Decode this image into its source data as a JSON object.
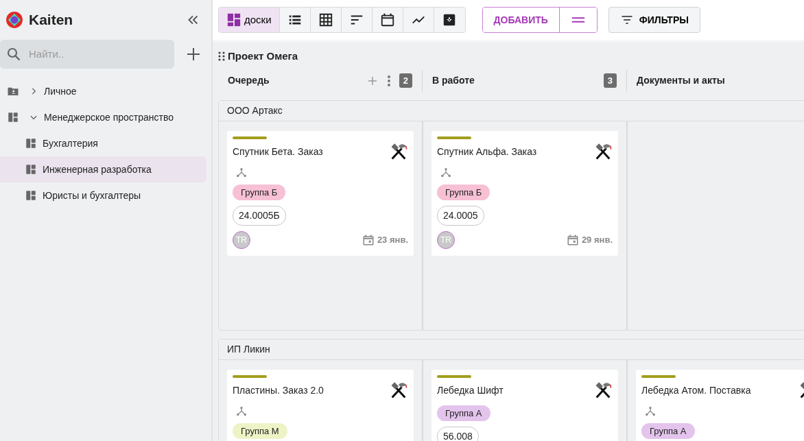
{
  "app": {
    "name": "Kaiten"
  },
  "sidebar": {
    "search": {
      "placeholder": "Найти.."
    },
    "items": [
      {
        "label": "Личное",
        "kind": "folder",
        "expanded": false,
        "selected": false
      },
      {
        "label": "Менеджерское пространство",
        "kind": "space",
        "expanded": true,
        "selected": false,
        "children": [
          {
            "label": "Бухгалтерия",
            "kind": "board",
            "selected": false
          },
          {
            "label": "Инженерная разработка",
            "kind": "board",
            "selected": true
          },
          {
            "label": "Юристы и бухгалтеры",
            "kind": "board",
            "selected": false
          }
        ]
      }
    ]
  },
  "toolbar": {
    "views": [
      {
        "kind": "boards",
        "label": "доски",
        "selected": true
      },
      {
        "kind": "list",
        "selected": false
      },
      {
        "kind": "table",
        "selected": false
      },
      {
        "kind": "sort",
        "selected": false
      },
      {
        "kind": "calendar",
        "selected": false
      },
      {
        "kind": "chart",
        "selected": false
      },
      {
        "kind": "archive",
        "selected": false
      }
    ],
    "add_button": "ДОБАВИТЬ",
    "filters_button": "ФИЛЬТРЫ"
  },
  "board": {
    "title": "Проект Омега",
    "columns": [
      {
        "name": "Очередь",
        "count": "2",
        "actions": true
      },
      {
        "name": "В работе",
        "count": "3",
        "actions": false
      },
      {
        "name": "Документы и акты",
        "actions": false
      }
    ],
    "lanes": [
      {
        "name": "ООО Артакс",
        "cells": [
          [
            {
              "title": "Спутник Бета. Заказ",
              "relation": true,
              "tag": {
                "label": "Группа Б",
                "color": "#f7c0d4"
              },
              "code": "24.0005Б",
              "avatar": "TR",
              "date": "23 янв."
            }
          ],
          [
            {
              "title": "Спутник Альфа. Заказ",
              "relation": true,
              "tag": {
                "label": "Группа Б",
                "color": "#f7c0d4"
              },
              "code": "24.0005",
              "avatar": "TR",
              "date": "29 янв."
            }
          ],
          []
        ]
      },
      {
        "name": "ИП Ликин",
        "cells": [
          [
            {
              "title": "Пластины. Заказ 2.0",
              "relation": true,
              "tag": {
                "label": "Группа М",
                "color": "#eef3c6"
              }
            }
          ],
          [
            {
              "title": "Лебедка Шифт",
              "relation": false,
              "tag": {
                "label": "Группа А",
                "color": "#e3c4ec"
              },
              "code": "56.008"
            }
          ],
          [
            {
              "title": "Лебедка Атом. Поставка",
              "relation": true,
              "tag": {
                "label": "Группа А",
                "color": "#e3c4ec"
              }
            }
          ]
        ]
      }
    ]
  }
}
